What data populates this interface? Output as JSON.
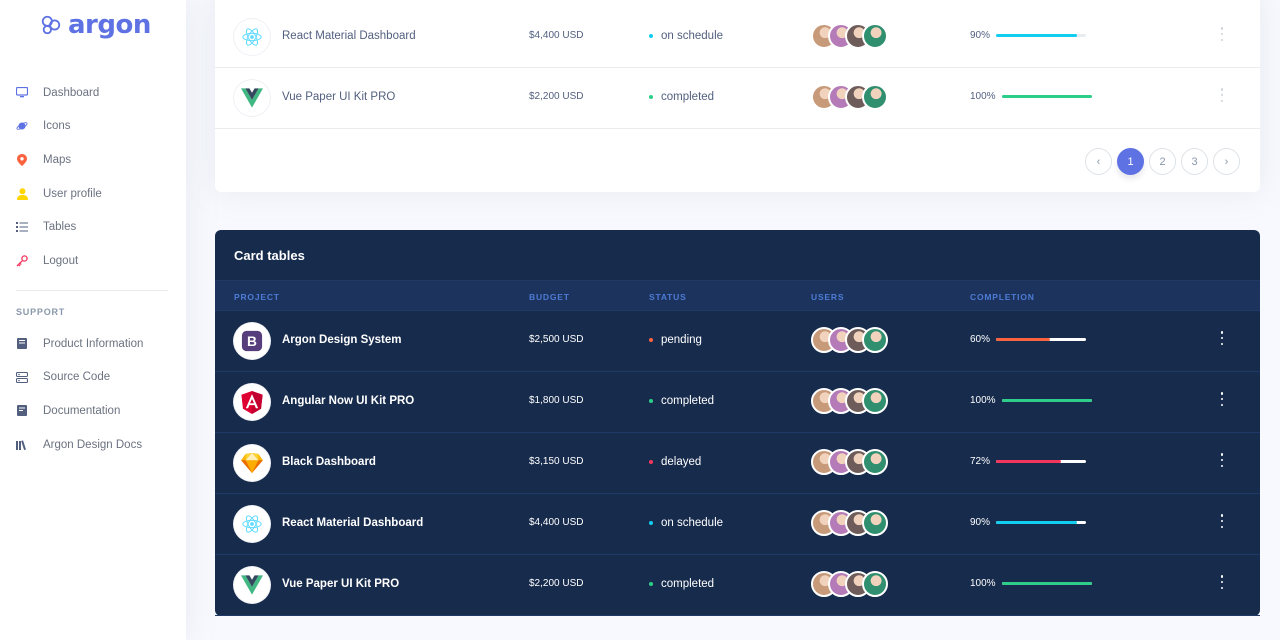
{
  "brand": {
    "name": "argon",
    "logo_icon": "atom-logo-icon",
    "color": "#5e72e4"
  },
  "nav": [
    {
      "label": "Dashboard",
      "icon": "tv-icon",
      "color": "#5e72e4"
    },
    {
      "label": "Icons",
      "icon": "planet-icon",
      "color": "#5e72e4"
    },
    {
      "label": "Maps",
      "icon": "pin-icon",
      "color": "#fb6340"
    },
    {
      "label": "User profile",
      "icon": "user-icon",
      "color": "#ffd600"
    },
    {
      "label": "Tables",
      "icon": "list-icon",
      "color": "#525f7f"
    },
    {
      "label": "Logout",
      "icon": "key-icon",
      "color": "#f5365c"
    }
  ],
  "support": {
    "heading": "SUPPORT",
    "items": [
      {
        "label": "Product Information",
        "icon": "book-icon"
      },
      {
        "label": "Source Code",
        "icon": "code-icon"
      },
      {
        "label": "Documentation",
        "icon": "doc-icon"
      },
      {
        "label": "Argon Design Docs",
        "icon": "library-icon"
      }
    ]
  },
  "light_table": {
    "rows": [
      {
        "project": "React Material Dashboard",
        "icon": "react-icon",
        "budget": "$4,400 USD",
        "status": "on schedule",
        "status_color": "#11cdef",
        "completion": "90%",
        "progress": 0.9,
        "bar_color": "#11cdef"
      },
      {
        "project": "Vue Paper UI Kit PRO",
        "icon": "vue-icon",
        "budget": "$2,200 USD",
        "status": "completed",
        "status_color": "#2dce89",
        "completion": "100%",
        "progress": 1.0,
        "bar_color": "#2dce89"
      }
    ],
    "pagination": {
      "prev": "‹",
      "pages": [
        "1",
        "2",
        "3"
      ],
      "next": "›",
      "active": "1"
    }
  },
  "dark_table": {
    "title": "Card tables",
    "headers": [
      "PROJECT",
      "BUDGET",
      "STATUS",
      "USERS",
      "COMPLETION"
    ],
    "rows": [
      {
        "project": "Argon Design System",
        "icon": "bootstrap-icon",
        "budget": "$2,500 USD",
        "status": "pending",
        "status_color": "#fb6340",
        "completion": "60%",
        "progress": 0.6,
        "bar_color": "#fb6340"
      },
      {
        "project": "Angular Now UI Kit PRO",
        "icon": "angular-icon",
        "budget": "$1,800 USD",
        "status": "completed",
        "status_color": "#2dce89",
        "completion": "100%",
        "progress": 1.0,
        "bar_color": "#2dce89"
      },
      {
        "project": "Black Dashboard",
        "icon": "sketch-icon",
        "budget": "$3,150 USD",
        "status": "delayed",
        "status_color": "#f5365c",
        "completion": "72%",
        "progress": 0.72,
        "bar_color": "#f5365c"
      },
      {
        "project": "React Material Dashboard",
        "icon": "react-icon",
        "budget": "$4,400 USD",
        "status": "on schedule",
        "status_color": "#11cdef",
        "completion": "90%",
        "progress": 0.9,
        "bar_color": "#11cdef"
      },
      {
        "project": "Vue Paper UI Kit PRO",
        "icon": "vue-icon",
        "budget": "$2,200 USD",
        "status": "completed",
        "status_color": "#2dce89",
        "completion": "100%",
        "progress": 1.0,
        "bar_color": "#2dce89"
      }
    ]
  },
  "avatar_colors": [
    "#c79a7a",
    "#b57bb8",
    "#6e5c5a",
    "#2f8f6f"
  ]
}
